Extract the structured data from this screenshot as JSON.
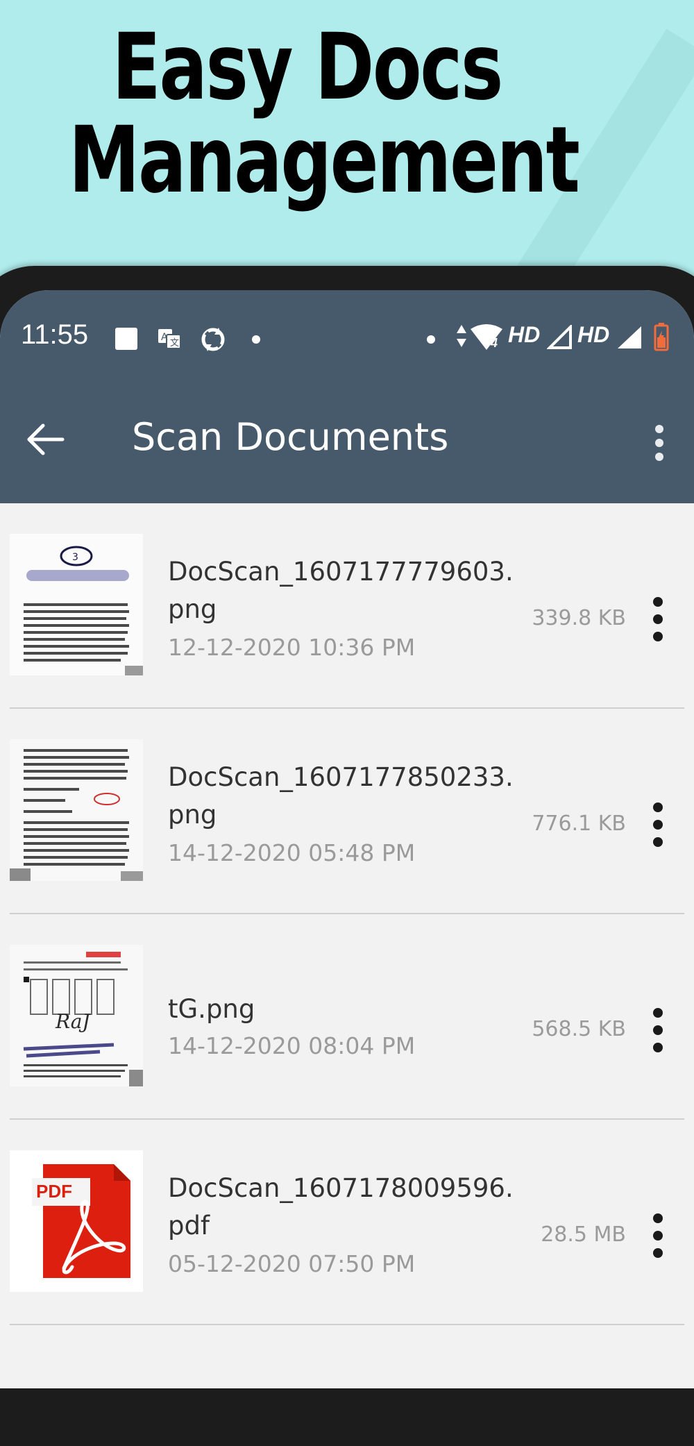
{
  "promo": {
    "title_line1": "Easy Docs",
    "title_line2": "Management"
  },
  "status_bar": {
    "time": "11:55",
    "network_label_1": "HD",
    "network_label_2": "HD",
    "wifi_badge": "4"
  },
  "toolbar": {
    "title": "Scan Documents",
    "back_icon": "arrow-left-icon",
    "overflow_icon": "more-vert-icon"
  },
  "documents": [
    {
      "name": "DocScan_1607177779603.png",
      "date": "12-12-2020 10:36 PM",
      "size": "339.8 KB",
      "thumb": "scan-page-icon"
    },
    {
      "name": "DocScan_1607177850233.png",
      "date": "14-12-2020 05:48 PM",
      "size": "776.1 KB",
      "thumb": "scan-page-icon"
    },
    {
      "name": "tG.png",
      "date": "14-12-2020 08:04 PM",
      "size": "568.5 KB",
      "thumb": "scan-page-icon"
    },
    {
      "name": "DocScan_1607178009596.pdf",
      "date": "05-12-2020 07:50 PM",
      "size": "28.5 MB",
      "thumb": "pdf-file-icon",
      "pdf_label": "PDF"
    }
  ],
  "colors": {
    "promo_background": "#b0ecec",
    "app_bar": "#475a6c",
    "list_background": "#f2f2f2",
    "pdf_red": "#dd1f10"
  }
}
